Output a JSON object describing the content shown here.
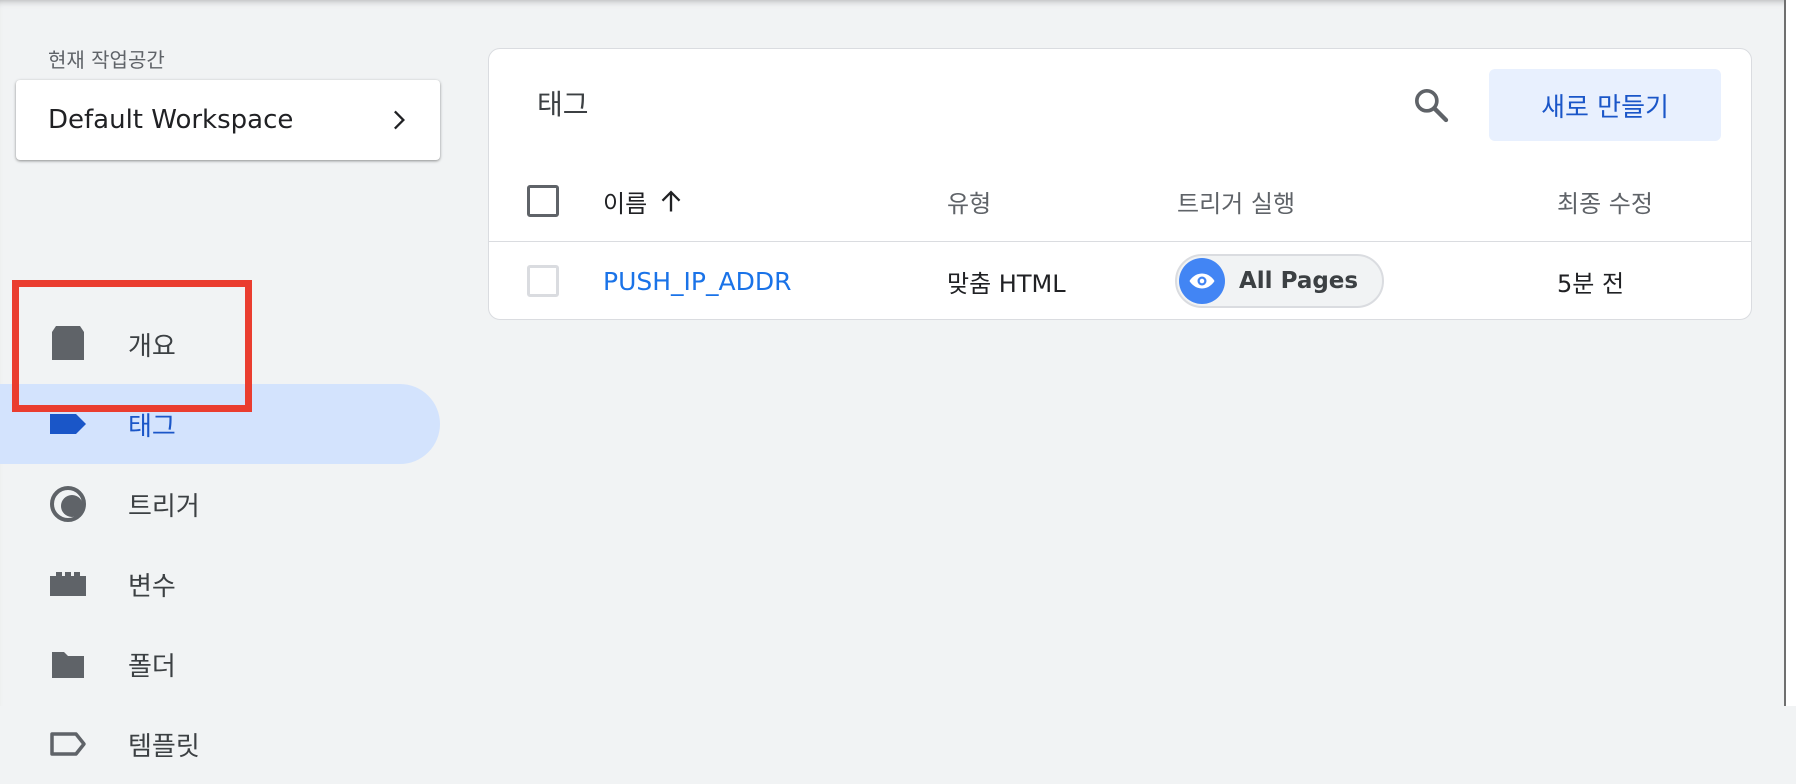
{
  "sidebar": {
    "workspace_caption": "현재 작업공간",
    "workspace_name": "Default Workspace",
    "items": [
      {
        "label": "개요",
        "icon": "overview-icon"
      },
      {
        "label": "태그",
        "icon": "tag-icon",
        "active": true
      },
      {
        "label": "트리거",
        "icon": "trigger-icon"
      },
      {
        "label": "변수",
        "icon": "variable-icon"
      },
      {
        "label": "폴더",
        "icon": "folder-icon"
      },
      {
        "label": "템플릿",
        "icon": "template-icon"
      }
    ]
  },
  "main": {
    "title": "태그",
    "new_button_label": "새로 만들기",
    "columns": {
      "name": "이름",
      "type": "유형",
      "firing_triggers": "트리거 실행",
      "last_edited": "최종 수정"
    },
    "rows": [
      {
        "name": "PUSH_IP_ADDR",
        "type": "맞춤 HTML",
        "trigger": "All Pages",
        "last_edited": "5분 전"
      }
    ]
  },
  "colors": {
    "accent": "#1a73e8",
    "active_nav_bg": "#d3e3fd",
    "highlight": "#ea3d2f",
    "icon_gray": "#5f6368"
  }
}
